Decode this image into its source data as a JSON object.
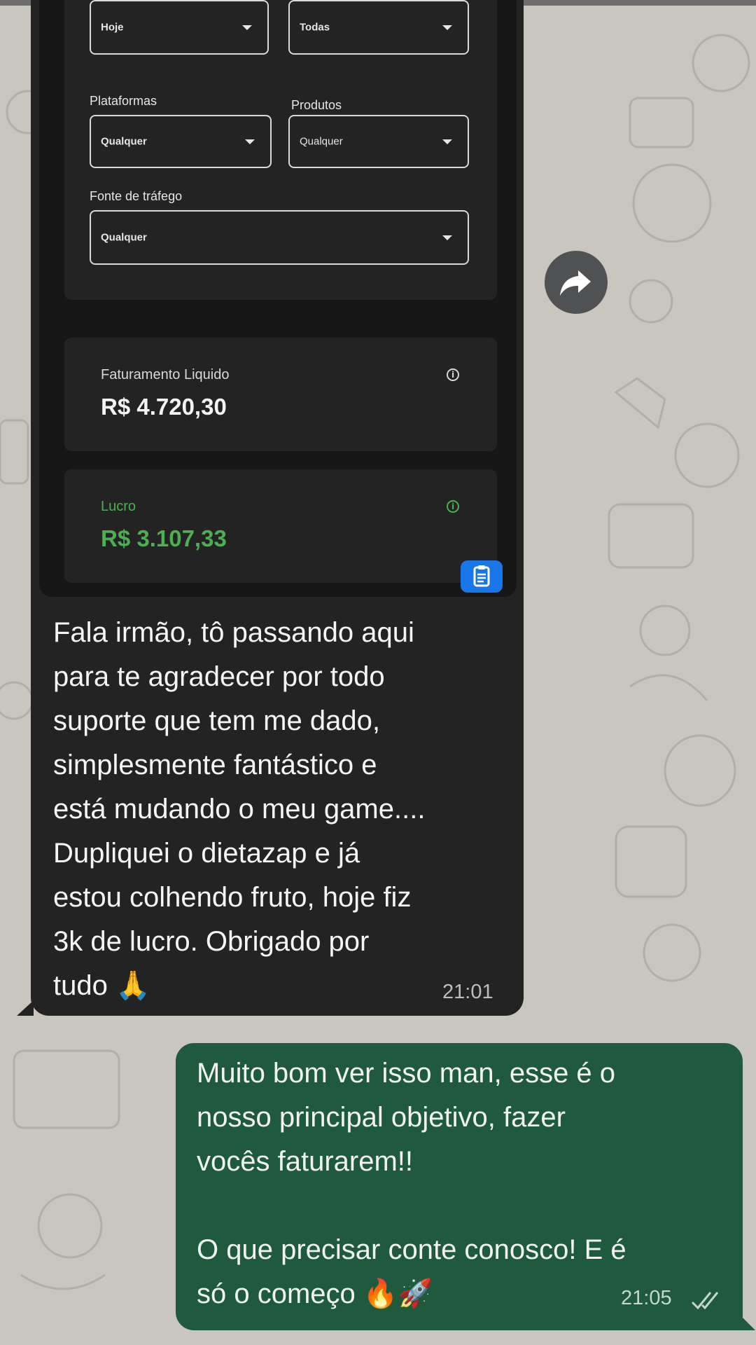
{
  "filters": {
    "period_value": "Hoje",
    "status_value": "Todas",
    "platforms_label": "Plataformas",
    "platforms_value": "Qualquer",
    "products_label": "Produtos",
    "products_value": "Qualquer",
    "traffic_label": "Fonte de tráfego",
    "traffic_value": "Qualquer"
  },
  "metrics": {
    "revenue_label": "Faturamento Liquido",
    "revenue_value": "R$ 4.720,30",
    "profit_label": "Lucro",
    "profit_value": "R$ 3.107,33"
  },
  "messages": {
    "incoming_text": "Fala irmão, tô passando aqui\npara te agradecer por todo\nsuporte que tem me dado,\nsimplesmente fantástico e\nestá mudando o meu game....\nDupliquei o dietazap e já\nestou colhendo fruto, hoje fiz\n3k de lucro. Obrigado por\ntudo 🙏",
    "incoming_time": "21:01",
    "outgoing_text": "Muito bom ver isso man, esse é o\nnosso principal objetivo, fazer\nvocês faturarem!!\n\nO que precisar conte conosco! E é\nsó o começo 🔥🚀",
    "outgoing_time": "21:05",
    "outgoing_status_icon": "double-check-icon"
  },
  "icons": {
    "forward": "forward-arrow-icon",
    "clipboard": "clipboard-icon",
    "info": "info-icon"
  },
  "colors": {
    "incoming_bubble": "#232323",
    "outgoing_bubble": "#1f5a3e",
    "profit_green": "#4caf50",
    "clipboard_blue": "#1976e8"
  }
}
